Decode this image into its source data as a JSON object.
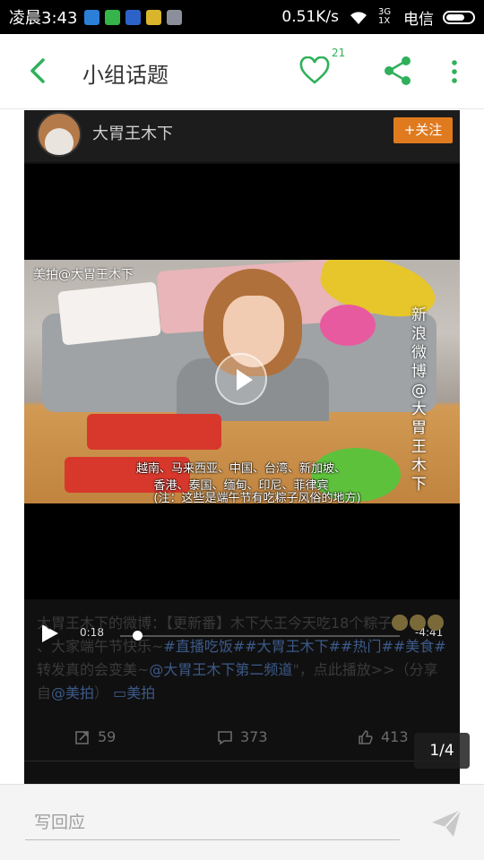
{
  "status_bar": {
    "time": "凌晨3:43",
    "net_speed": "0.51K/s",
    "signal": "3G 1X",
    "carrier": "电信",
    "app_icons": [
      "app-icon-blue",
      "shield-icon",
      "chat-icon",
      "game-icon",
      "image-icon"
    ]
  },
  "app_bar": {
    "title": "小组话题",
    "like_count": "21",
    "icons": [
      "back-icon",
      "heart-icon",
      "share-icon",
      "more-icon"
    ]
  },
  "post": {
    "author": "大胃王木下",
    "follow_label": "+关注",
    "video": {
      "watermark": "美拍@大胃王木下",
      "vertical_watermark": "新浪微博@大胃王木下",
      "subtitle_line1": "越南、马来西亚、中国、台湾、新加坡、",
      "subtitle_line1b": "香港、泰国、缅甸、印尼、菲律宾",
      "subtitle_line2": "(注：这些是端午节有吃粽子风俗的地方)",
      "elapsed": "0:18",
      "remaining": "-4:41",
      "progress": 0.06
    },
    "text": {
      "prefix": "大胃王木下的微博：【更新番】木下大王今天吃18个粽子",
      "middle": "、大家端午节快乐~",
      "link1": "#直播吃饭##大胃王木下##热门##美食#",
      "after_link1": "转发真的会变美~",
      "link2": "@大胃王木下第二频道",
      "after_link2": "\"，点此播放>>（分享自",
      "link3": "@美拍",
      "after_link3": "）",
      "link4": "美拍"
    },
    "stats": {
      "reposts": "59",
      "comments": "373",
      "likes": "413"
    }
  },
  "pager": "1/4",
  "reply": {
    "placeholder": "写回应"
  }
}
